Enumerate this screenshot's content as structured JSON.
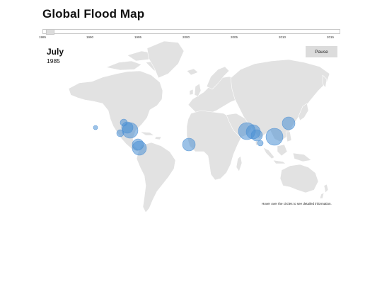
{
  "title": "Global Flood Map",
  "timeline": {
    "ticks": [
      "1985",
      "1990",
      "1995",
      "2000",
      "2005",
      "2010",
      "2015"
    ],
    "current": 1985
  },
  "date": {
    "month": "July",
    "year": "1985"
  },
  "controls": {
    "pause_label": "Pause"
  },
  "hint": "Hover over the circles to see detailed information.",
  "colors": {
    "land": "#e2e2e2",
    "border": "#ffffff",
    "bubble": "#4a8fd4"
  },
  "floods": [
    {
      "lon": -95,
      "lat": 37,
      "size": 3
    },
    {
      "lon": -90,
      "lat": 30,
      "size": 6
    },
    {
      "lon": -86,
      "lat": 26,
      "size": 9
    },
    {
      "lon": -100,
      "lat": 22,
      "size": 3
    },
    {
      "lon": -75,
      "lat": 6,
      "size": 6
    },
    {
      "lon": -73,
      "lat": 1,
      "size": 8
    },
    {
      "lon": -3,
      "lat": 6,
      "size": 7
    },
    {
      "lon": 79,
      "lat": 25,
      "size": 10
    },
    {
      "lon": 88,
      "lat": 24,
      "size": 8
    },
    {
      "lon": 93,
      "lat": 19,
      "size": 6
    },
    {
      "lon": 118,
      "lat": 17,
      "size": 10
    },
    {
      "lon": 138,
      "lat": 36,
      "size": 7
    },
    {
      "lon": 98,
      "lat": 8,
      "size": 2
    },
    {
      "lon": -135,
      "lat": 30,
      "size": 1
    }
  ]
}
